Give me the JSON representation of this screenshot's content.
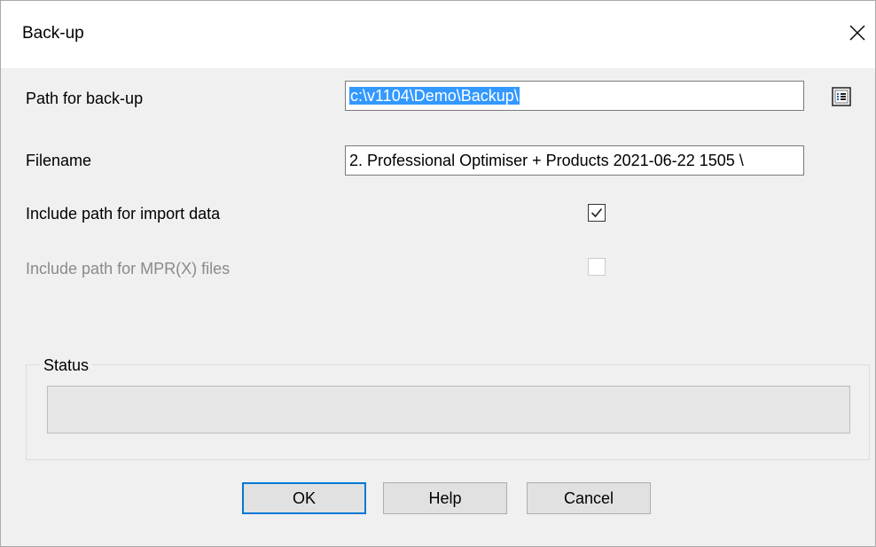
{
  "window": {
    "title": "Back-up"
  },
  "fields": {
    "path_label": "Path for back-up",
    "path_value": "c:\\v1104\\Demo\\Backup\\",
    "filename_label": "Filename",
    "filename_value": "2. Professional Optimiser + Products 2021-06-22 1505 \\"
  },
  "options": {
    "include_import_label": "Include path for import data",
    "include_import_checked": true,
    "include_mpr_label": "Include path for MPR(X) files",
    "include_mpr_checked": false,
    "include_mpr_enabled": false
  },
  "status": {
    "label": "Status",
    "progress": 0
  },
  "buttons": {
    "ok": "OK",
    "help": "Help",
    "cancel": "Cancel"
  },
  "icons": {
    "close": "close-icon",
    "browse": "folder-browse-icon",
    "check": "checkmark-icon"
  },
  "colors": {
    "selection": "#3399ff",
    "default_button_border": "#0078d7"
  }
}
